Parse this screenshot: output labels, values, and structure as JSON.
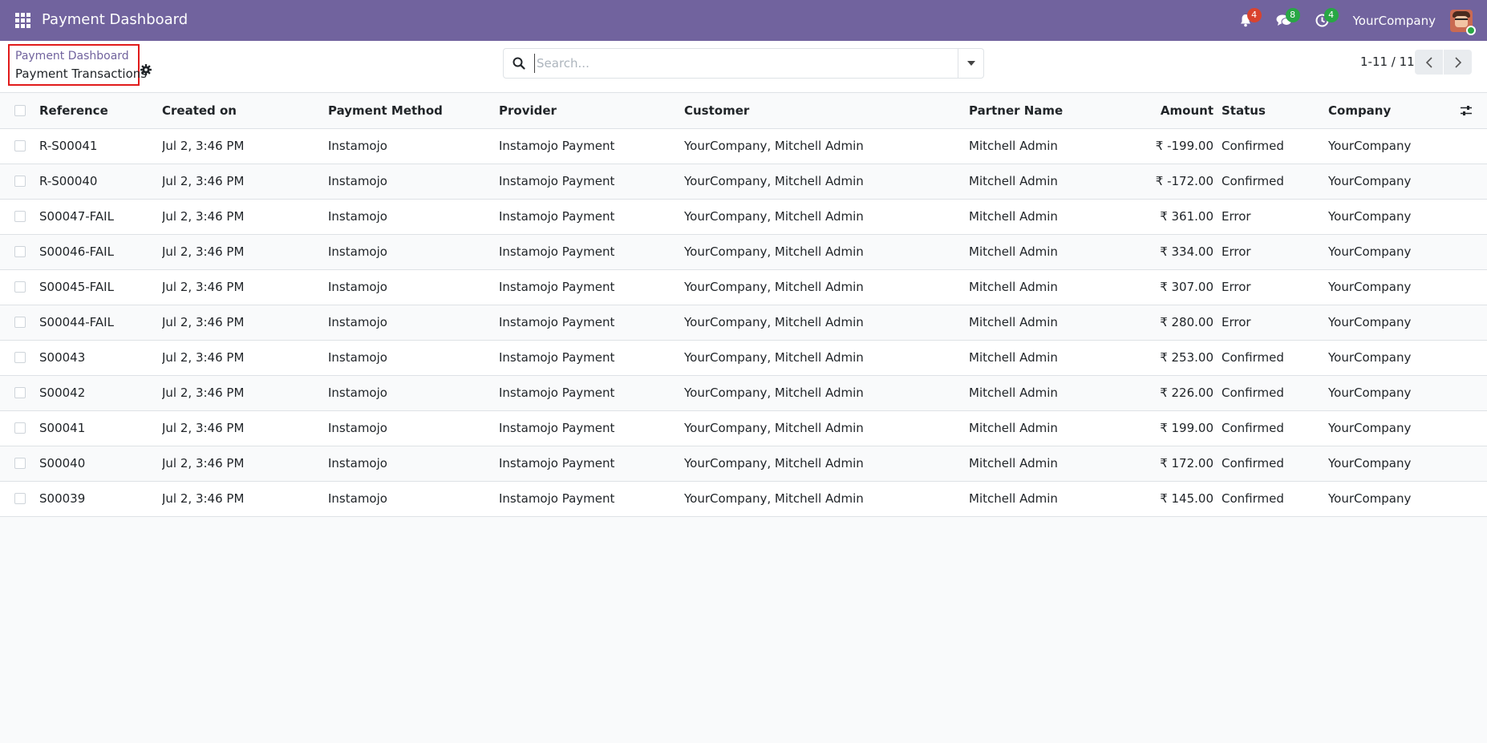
{
  "app": {
    "title": "Payment Dashboard",
    "brand_color": "#71639e"
  },
  "systray": {
    "notifications_count": "4",
    "messages_count": "8",
    "activities_count": "4",
    "company": "YourCompany"
  },
  "breadcrumb": {
    "parent": "Payment Dashboard",
    "current": "Payment Transactions"
  },
  "search": {
    "placeholder": "Search..."
  },
  "pager": {
    "value": "1-11 / 11"
  },
  "table": {
    "columns": {
      "reference": "Reference",
      "created_on": "Created on",
      "payment_method": "Payment Method",
      "provider": "Provider",
      "customer": "Customer",
      "partner_name": "Partner Name",
      "amount": "Amount",
      "status": "Status",
      "company": "Company"
    },
    "rows": [
      {
        "reference": "R-S00041",
        "created_on": "Jul 2, 3:46 PM",
        "payment_method": "Instamojo",
        "provider": "Instamojo Payment",
        "customer": "YourCompany, Mitchell Admin",
        "partner_name": "Mitchell Admin",
        "amount": "₹ -199.00",
        "status": "Confirmed",
        "company": "YourCompany"
      },
      {
        "reference": "R-S00040",
        "created_on": "Jul 2, 3:46 PM",
        "payment_method": "Instamojo",
        "provider": "Instamojo Payment",
        "customer": "YourCompany, Mitchell Admin",
        "partner_name": "Mitchell Admin",
        "amount": "₹ -172.00",
        "status": "Confirmed",
        "company": "YourCompany"
      },
      {
        "reference": "S00047-FAIL",
        "created_on": "Jul 2, 3:46 PM",
        "payment_method": "Instamojo",
        "provider": "Instamojo Payment",
        "customer": "YourCompany, Mitchell Admin",
        "partner_name": "Mitchell Admin",
        "amount": "₹ 361.00",
        "status": "Error",
        "company": "YourCompany"
      },
      {
        "reference": "S00046-FAIL",
        "created_on": "Jul 2, 3:46 PM",
        "payment_method": "Instamojo",
        "provider": "Instamojo Payment",
        "customer": "YourCompany, Mitchell Admin",
        "partner_name": "Mitchell Admin",
        "amount": "₹ 334.00",
        "status": "Error",
        "company": "YourCompany"
      },
      {
        "reference": "S00045-FAIL",
        "created_on": "Jul 2, 3:46 PM",
        "payment_method": "Instamojo",
        "provider": "Instamojo Payment",
        "customer": "YourCompany, Mitchell Admin",
        "partner_name": "Mitchell Admin",
        "amount": "₹ 307.00",
        "status": "Error",
        "company": "YourCompany"
      },
      {
        "reference": "S00044-FAIL",
        "created_on": "Jul 2, 3:46 PM",
        "payment_method": "Instamojo",
        "provider": "Instamojo Payment",
        "customer": "YourCompany, Mitchell Admin",
        "partner_name": "Mitchell Admin",
        "amount": "₹ 280.00",
        "status": "Error",
        "company": "YourCompany"
      },
      {
        "reference": "S00043",
        "created_on": "Jul 2, 3:46 PM",
        "payment_method": "Instamojo",
        "provider": "Instamojo Payment",
        "customer": "YourCompany, Mitchell Admin",
        "partner_name": "Mitchell Admin",
        "amount": "₹ 253.00",
        "status": "Confirmed",
        "company": "YourCompany"
      },
      {
        "reference": "S00042",
        "created_on": "Jul 2, 3:46 PM",
        "payment_method": "Instamojo",
        "provider": "Instamojo Payment",
        "customer": "YourCompany, Mitchell Admin",
        "partner_name": "Mitchell Admin",
        "amount": "₹ 226.00",
        "status": "Confirmed",
        "company": "YourCompany"
      },
      {
        "reference": "S00041",
        "created_on": "Jul 2, 3:46 PM",
        "payment_method": "Instamojo",
        "provider": "Instamojo Payment",
        "customer": "YourCompany, Mitchell Admin",
        "partner_name": "Mitchell Admin",
        "amount": "₹ 199.00",
        "status": "Confirmed",
        "company": "YourCompany"
      },
      {
        "reference": "S00040",
        "created_on": "Jul 2, 3:46 PM",
        "payment_method": "Instamojo",
        "provider": "Instamojo Payment",
        "customer": "YourCompany, Mitchell Admin",
        "partner_name": "Mitchell Admin",
        "amount": "₹ 172.00",
        "status": "Confirmed",
        "company": "YourCompany"
      },
      {
        "reference": "S00039",
        "created_on": "Jul 2, 3:46 PM",
        "payment_method": "Instamojo",
        "provider": "Instamojo Payment",
        "customer": "YourCompany, Mitchell Admin",
        "partner_name": "Mitchell Admin",
        "amount": "₹ 145.00",
        "status": "Confirmed",
        "company": "YourCompany"
      }
    ]
  }
}
